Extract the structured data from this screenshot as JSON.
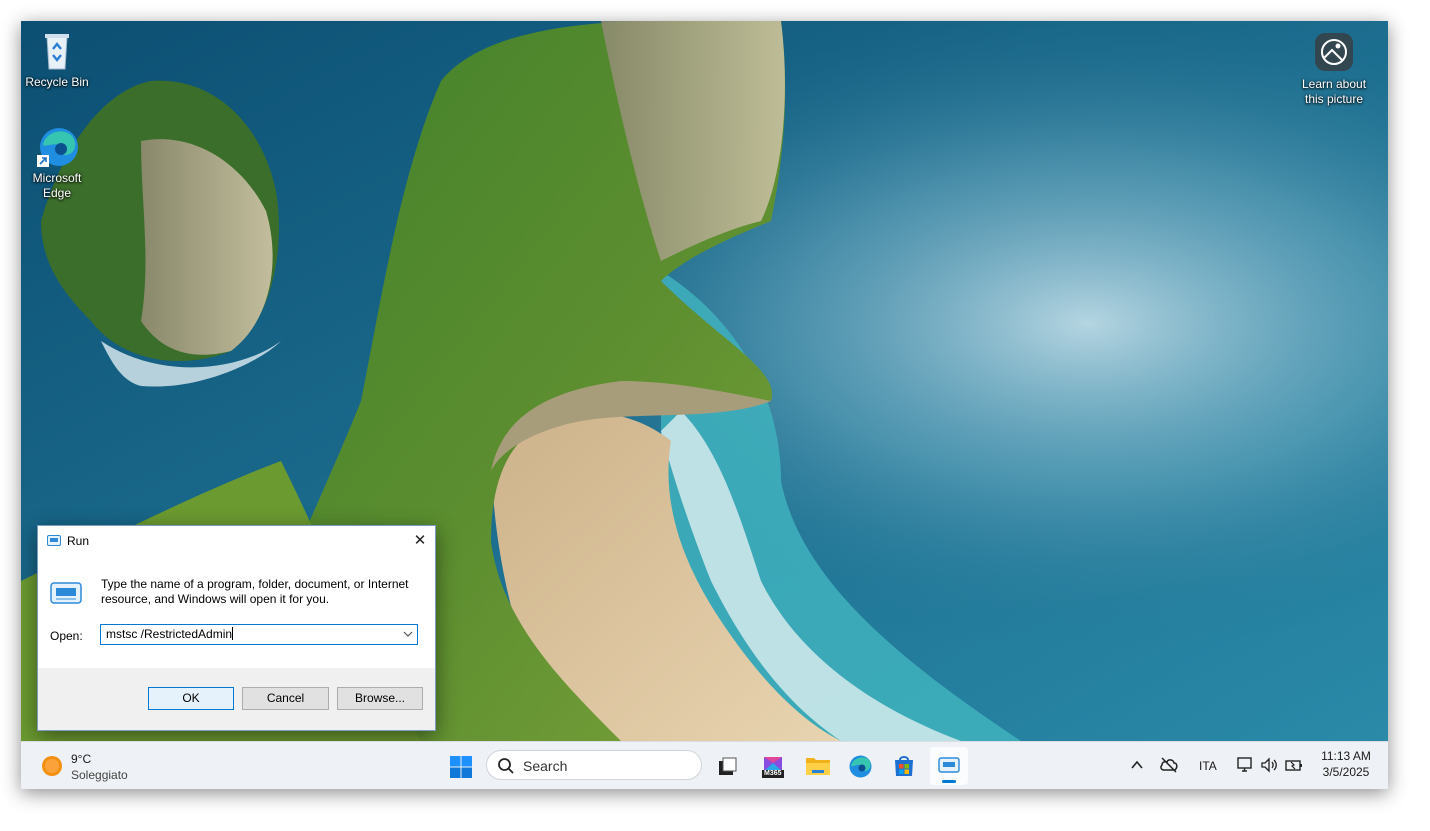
{
  "desktop": {
    "icons": [
      {
        "label": "Recycle Bin",
        "icon": "recycle-bin-icon"
      },
      {
        "label": "Microsoft Edge",
        "icon": "edge-icon"
      },
      {
        "label": "Learn about this picture",
        "icon": "learn-picture-icon"
      }
    ]
  },
  "run_dialog": {
    "title": "Run",
    "close_label": "✕",
    "description": "Type the name of a program, folder, document, or Internet resource, and Windows will open it for you.",
    "open_label": "Open:",
    "open_value": "mstsc /RestrictedAdmin",
    "ok_label": "OK",
    "cancel_label": "Cancel",
    "browse_label": "Browse..."
  },
  "taskbar": {
    "weather": {
      "temp": "9°C",
      "condition": "Soleggiato"
    },
    "search_placeholder": "Search",
    "apps": [
      "start-icon",
      "task-view-icon",
      "m365-icon",
      "file-explorer-icon",
      "edge-icon",
      "store-icon",
      "run-icon"
    ],
    "m365_badge": "M365",
    "tray": {
      "language": "ITA",
      "time": "11:13 AM",
      "date": "3/5/2025"
    }
  },
  "colors": {
    "accent": "#0078d4",
    "taskbar_bg": "#eef1f6"
  }
}
